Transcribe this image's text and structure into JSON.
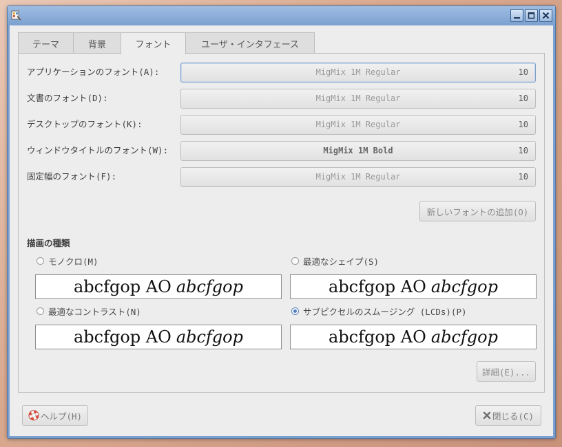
{
  "window": {
    "minimize_icon": "minimize-icon",
    "maximize_icon": "maximize-icon",
    "close_icon": "close-icon",
    "app_icon": "appearance-icon"
  },
  "tabs": [
    {
      "label": "テーマ"
    },
    {
      "label": "背景"
    },
    {
      "label": "フォント"
    },
    {
      "label": "ユーザ・インタフェース"
    }
  ],
  "fonts": [
    {
      "label": "アプリケーションのフォント(A):",
      "font": "MigMix 1M Regular",
      "size": "10"
    },
    {
      "label": "文書のフォント(D):",
      "font": "MigMix 1M Regular",
      "size": "10"
    },
    {
      "label": "デスクトップのフォント(K):",
      "font": "MigMix 1M Regular",
      "size": "10"
    },
    {
      "label": "ウィンドウタイトルのフォント(W):",
      "font": "MigMix 1M Bold",
      "size": "10"
    },
    {
      "label": "固定幅のフォント(F):",
      "font": "MigMix 1M Regular",
      "size": "10"
    }
  ],
  "add_font_button": "新しいフォントの追加(O)",
  "rendering": {
    "title": "描画の種類",
    "options": [
      {
        "label": "モノクロ(M)",
        "checked": false
      },
      {
        "label": "最適なシェイプ(S)",
        "checked": false
      },
      {
        "label": "最適なコントラスト(N)",
        "checked": false
      },
      {
        "label": "サブピクセルのスムージング (LCDs)(P)",
        "checked": true
      }
    ],
    "sample_regular": "abcfgop AO",
    "sample_italic": "abcfgop"
  },
  "details_button": "詳細(E)...",
  "help_button": "ヘルプ(H)",
  "close_button": "閉じる(C)",
  "colors": {
    "titlebar": "#7ba0cf",
    "accent_radio": "#4f7fc0"
  }
}
